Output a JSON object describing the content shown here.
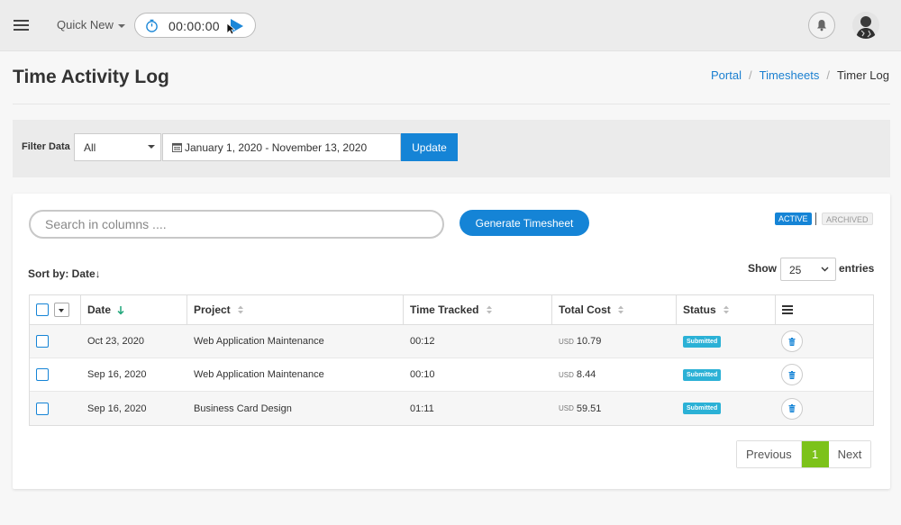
{
  "topbar": {
    "quick_new_label": "Quick New",
    "timer_value": "00:00:00"
  },
  "header": {
    "title": "Time Activity Log",
    "breadcrumb": [
      "Portal",
      "Timesheets",
      "Timer Log"
    ]
  },
  "filter": {
    "label": "Filter Data",
    "select_value": "All",
    "date_range": "January 1, 2020 - November 13, 2020",
    "update_label": "Update"
  },
  "toolbar": {
    "search_placeholder": "Search in columns ....",
    "generate_label": "Generate Timesheet",
    "active_label": "ACTIVE",
    "archived_label": "ARCHIVED",
    "sort_by_label": "Sort by: Date↓",
    "show_label": "Show",
    "page_size": "25",
    "entries_label": "entries"
  },
  "table": {
    "columns": [
      "Date",
      "Project",
      "Time Tracked",
      "Total Cost",
      "Status"
    ],
    "rows": [
      {
        "date": "Oct 23, 2020",
        "project": "Web Application Maintenance",
        "time": "00:12",
        "currency": "USD",
        "cost": "10.79",
        "status": "Submitted"
      },
      {
        "date": "Sep 16, 2020",
        "project": "Web Application Maintenance",
        "time": "00:10",
        "currency": "USD",
        "cost": "8.44",
        "status": "Submitted"
      },
      {
        "date": "Sep 16, 2020",
        "project": "Business Card Design",
        "time": "01:11",
        "currency": "USD",
        "cost": "59.51",
        "status": "Submitted"
      }
    ]
  },
  "pagination": {
    "previous_label": "Previous",
    "current_page": "1",
    "next_label": "Next"
  },
  "colors": {
    "primary": "#1584d6",
    "badge": "#2bb1d6",
    "page_active": "#7cc21a"
  }
}
